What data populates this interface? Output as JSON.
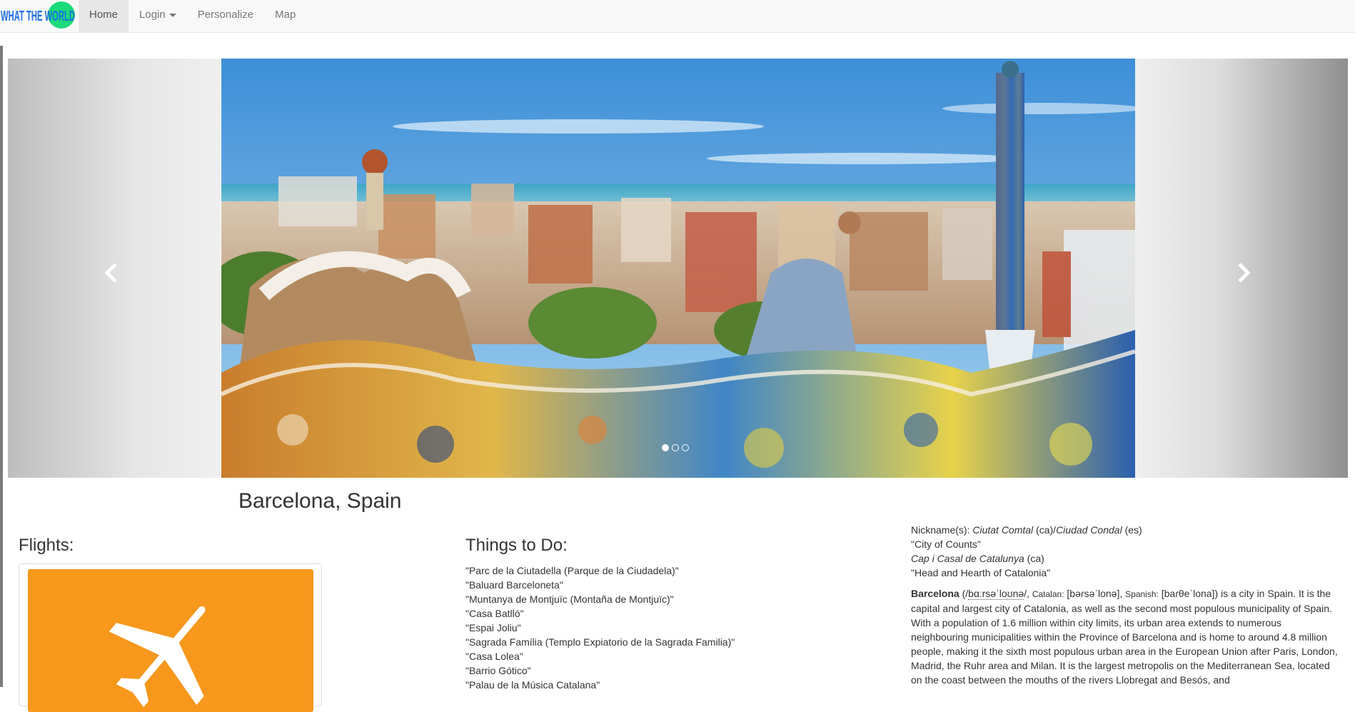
{
  "brand": {
    "text": "WHAT THE WORLD",
    "accent": "#1e90ff",
    "globe": "#1bdb7a"
  },
  "nav": {
    "home": "Home",
    "login": "Login",
    "personalize": "Personalize",
    "map": "Map"
  },
  "carousel": {
    "image_alt": "Park Güell overlooking Barcelona",
    "indicators": [
      true,
      false,
      false
    ]
  },
  "city": {
    "title": "Barcelona, Spain"
  },
  "flights": {
    "heading": "Flights:",
    "tile_color": "#f7981d",
    "icon": "airplane-icon"
  },
  "todo": {
    "heading": "Things to Do:",
    "items": [
      "\"Parc de la Ciutadella (Parque de la Ciudadela)\"",
      "\"Baluard Barceloneta\"",
      "\"Muntanya de Montjuïc (Montaña de Montjuïc)\"",
      "\"Casa Batlló\"",
      "\"Espai Joliu\"",
      "\"Sagrada Família (Templo Expiatorio de la Sagrada Familia)\"",
      "\"Casa Lolea\"",
      "\"Barrio Gótico\"",
      "\"Palau de la Música Catalana\""
    ]
  },
  "info": {
    "nick_label": "Nickname(s):",
    "nick1": "Ciutat Comtal",
    "nick1_lang": " (ca)/",
    "nick2": "Ciudad Condal",
    "nick2_lang": " (es)",
    "line2": "\"City of Counts\"",
    "nick3": "Cap i Casal de Catalunya",
    "nick3_lang": " (ca)",
    "line4": "\"Head and Hearth of Catalonia\"",
    "name": "Barcelona",
    "ipa_open": " (/",
    "ipa": "bɑːrsəˈloʊnə",
    "ipa_close": "/, ",
    "catalan_label": "Catalan:",
    "catalan_ipa": " [bəɾsəˈlonə], ",
    "spanish_label": "Spanish:",
    "spanish_ipa": " [baɾθeˈlona]",
    "description": ") is a city in Spain. It is the capital and largest city of Catalonia, as well as the second most populous municipality of Spain. With a population of 1.6 million within city limits, its urban area extends to numerous neighbouring municipalities within the Province of Barcelona and is home to around 4.8 million people, making it the sixth most populous urban area in the European Union after Paris, London, Madrid, the Ruhr area and Milan. It is the largest metropolis on the Mediterranean Sea, located on the coast between the mouths of the rivers Llobregat and Besós, and"
  }
}
